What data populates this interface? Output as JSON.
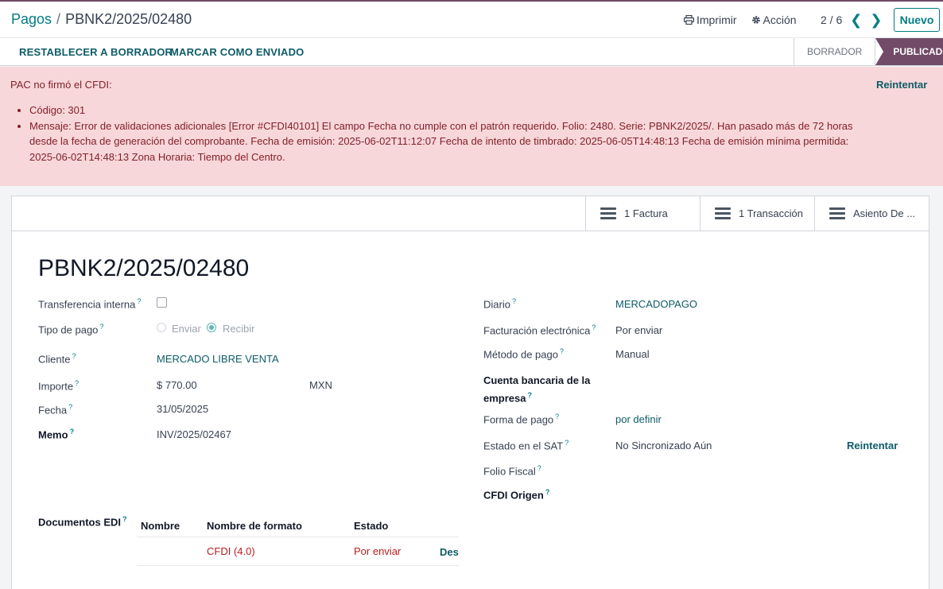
{
  "breadcrumb": {
    "parent": "Pagos",
    "separator": "/",
    "current": "PBNK2/2025/02480"
  },
  "actions": {
    "print": "Imprimir",
    "action": "Acción"
  },
  "pager": {
    "value": "2 / 6",
    "prev": "❮",
    "next": "❯"
  },
  "new_button": "Nuevo",
  "statusbar": {
    "reset": "RESTABLECER A BORRADOR",
    "mark_sent": "MARCAR COMO ENVIADO",
    "stages": [
      "BORRADOR",
      "PUBLICADO"
    ],
    "active_stage": "PUBLICADO"
  },
  "alert": {
    "title": "PAC no firmó el CFDI:",
    "retry": "Reintentar",
    "items": [
      "Código: 301",
      "Mensaje: Error de validaciones adicionales [Error #CFDI40101] El campo Fecha no cumple con el patrón requerido. Folio: 2480. Serie: PBNK2/2025/. Han pasado más de 72 horas desde la fecha de generación del comprobante. Fecha de emisión: 2025-06-02T11:12:07 Fecha de intento de timbrado: 2025-06-05T14:48:13 Fecha de emisión mínima permitida: 2025-06-02T14:48:13 Zona Horaria: Tiempo del Centro."
    ]
  },
  "smart_buttons": {
    "invoice": "1 Factura",
    "transaction": "1 Transacción",
    "entry": "Asiento De ..."
  },
  "record_title": "PBNK2/2025/02480",
  "help_mark": "?",
  "left": {
    "internal_transfer": {
      "label": "Transferencia interna",
      "checked": false
    },
    "payment_type": {
      "label": "Tipo de pago",
      "options": [
        "Enviar",
        "Recibir"
      ],
      "selected": "Recibir"
    },
    "customer": {
      "label": "Cliente",
      "value": "MERCADO LIBRE VENTA"
    },
    "amount": {
      "label": "Importe",
      "value": "$ 770.00",
      "currency": "MXN"
    },
    "date": {
      "label": "Fecha",
      "value": "31/05/2025"
    },
    "memo": {
      "label": "Memo",
      "value": "INV/2025/02467"
    },
    "edi": {
      "label": "Documentos EDI"
    }
  },
  "right": {
    "journal": {
      "label": "Diario",
      "value": "MERCADOPAGO"
    },
    "e_invoicing": {
      "label": "Facturación electrónica",
      "value": "Por enviar"
    },
    "payment_method": {
      "label": "Método de pago",
      "value": "Manual"
    },
    "bank_account": {
      "label_line1": "Cuenta bancaria de la",
      "label_line2": "empresa"
    },
    "payment_form": {
      "label": "Forma de pago",
      "value": "por definir"
    },
    "sat_state": {
      "label": "Estado en el SAT",
      "value": "No Sincronizado Aún",
      "retry": "Reintentar"
    },
    "fiscal_folio": {
      "label": "Folio Fiscal"
    },
    "cfdi_origin": {
      "label": "CFDI Origen"
    }
  },
  "edi_table": {
    "headers": [
      "Nombre",
      "Nombre de formato",
      "Estado"
    ],
    "rows": [
      {
        "name": "",
        "format": "CFDI (4.0)",
        "state": "Por enviar",
        "action": "Desc"
      }
    ]
  },
  "colors": {
    "accent": "#017e84",
    "brand": "#714b67",
    "danger": "#842029",
    "alert_bg": "#f7d7da"
  }
}
